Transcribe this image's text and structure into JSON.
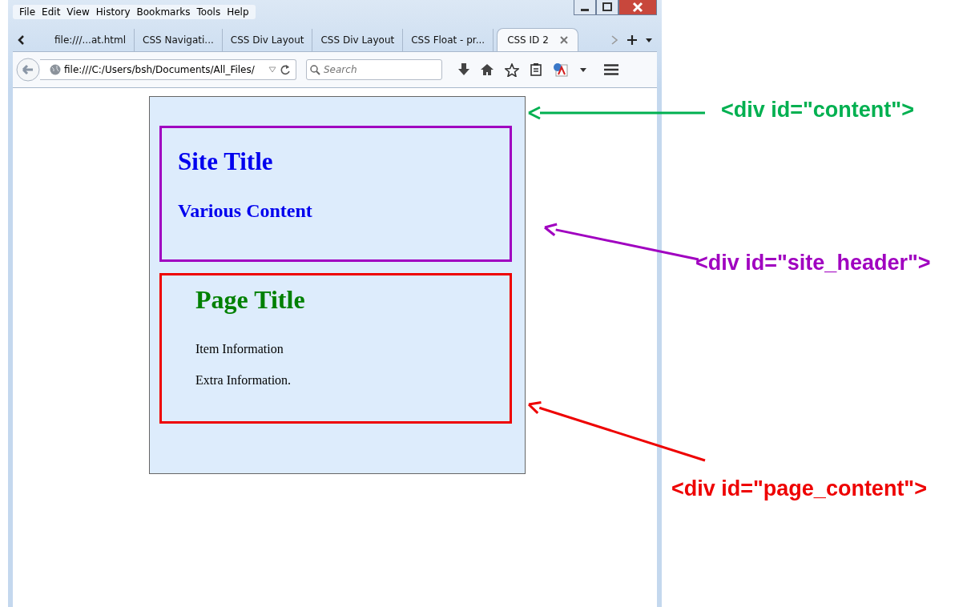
{
  "menu": [
    {
      "label": "File"
    },
    {
      "label": "Edit"
    },
    {
      "label": "View"
    },
    {
      "label": "History"
    },
    {
      "label": "Bookmarks"
    },
    {
      "label": "Tools"
    },
    {
      "label": "Help"
    }
  ],
  "tabs": [
    {
      "label": "file:///...at.html",
      "selected": false
    },
    {
      "label": "CSS Navigati...",
      "selected": false
    },
    {
      "label": "CSS Div Layout",
      "selected": false
    },
    {
      "label": "CSS Div Layout",
      "selected": false
    },
    {
      "label": "CSS Float - pr...",
      "selected": false
    },
    {
      "label": "CSS ID 2",
      "selected": true
    }
  ],
  "address": {
    "value": "file:///C:/Users/bsh/Documents/All_Files/"
  },
  "search": {
    "placeholder": "Search"
  },
  "page": {
    "site_header": {
      "title": "Site Title",
      "subtitle": "Various Content"
    },
    "page_content": {
      "title": "Page Title",
      "items": [
        "Item Information",
        "Extra Information."
      ]
    }
  },
  "annotations": [
    {
      "label": "<div id=\"content\">",
      "color": "#00b050"
    },
    {
      "label": "<div id=\"site_header\">",
      "color": "#a000c0"
    },
    {
      "label": "<div id=\"page_content\">",
      "color": "#ee0000"
    }
  ]
}
